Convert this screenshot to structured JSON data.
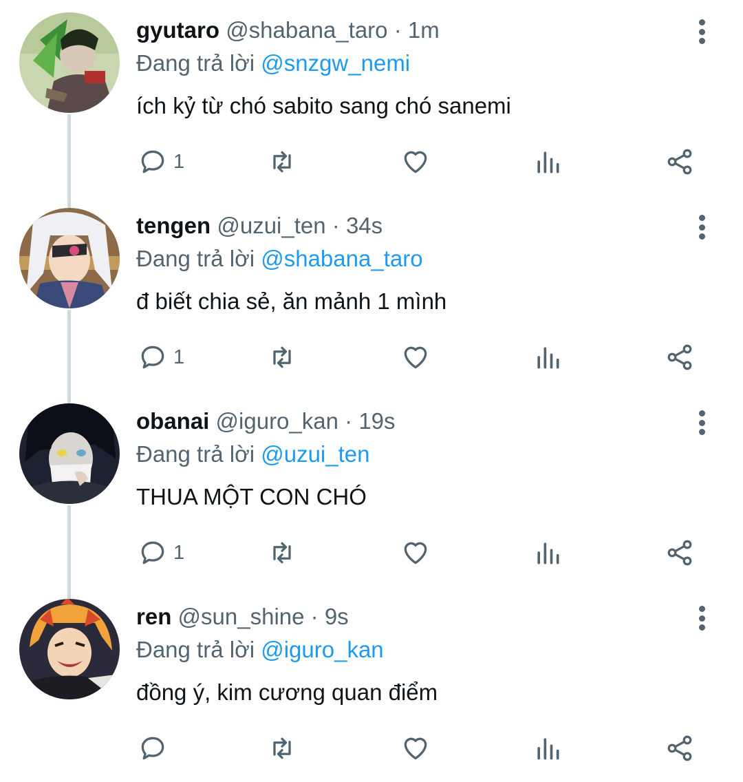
{
  "colors": {
    "name": "#0f1419",
    "muted": "#536471",
    "mention": "#1d9bf0",
    "thread_line": "#cfd9de"
  },
  "tweets": [
    {
      "display_name": "gyutaro",
      "handle": "@shabana_taro",
      "time": "· 1m",
      "reply_prefix": "Đang trả lời",
      "reply_to": "@snzgw_nemi",
      "text": "ích kỷ từ chó sabito sang chó sanemi",
      "reply_count": "1",
      "avatar_icon": "avatar-gyutaro"
    },
    {
      "display_name": "tengen",
      "handle": "@uzui_ten",
      "time": "· 34s",
      "reply_prefix": "Đang trả lời",
      "reply_to": "@shabana_taro",
      "text": "đ biết chia sẻ, ăn mảnh 1 mình",
      "reply_count": "1",
      "avatar_icon": "avatar-tengen"
    },
    {
      "display_name": "obanai",
      "handle": "@iguro_kan",
      "time": "· 19s",
      "reply_prefix": "Đang trả lời",
      "reply_to": "@uzui_ten",
      "text": "THUA MỘT CON CHÓ",
      "reply_count": "1",
      "avatar_icon": "avatar-obanai"
    },
    {
      "display_name": "ren",
      "handle": "@sun_shine",
      "time": "· 9s",
      "reply_prefix": "Đang trả lời",
      "reply_to": "@iguro_kan",
      "text": "đồng ý, kim cương quan điểm",
      "reply_count": "",
      "avatar_icon": "avatar-ren"
    }
  ]
}
